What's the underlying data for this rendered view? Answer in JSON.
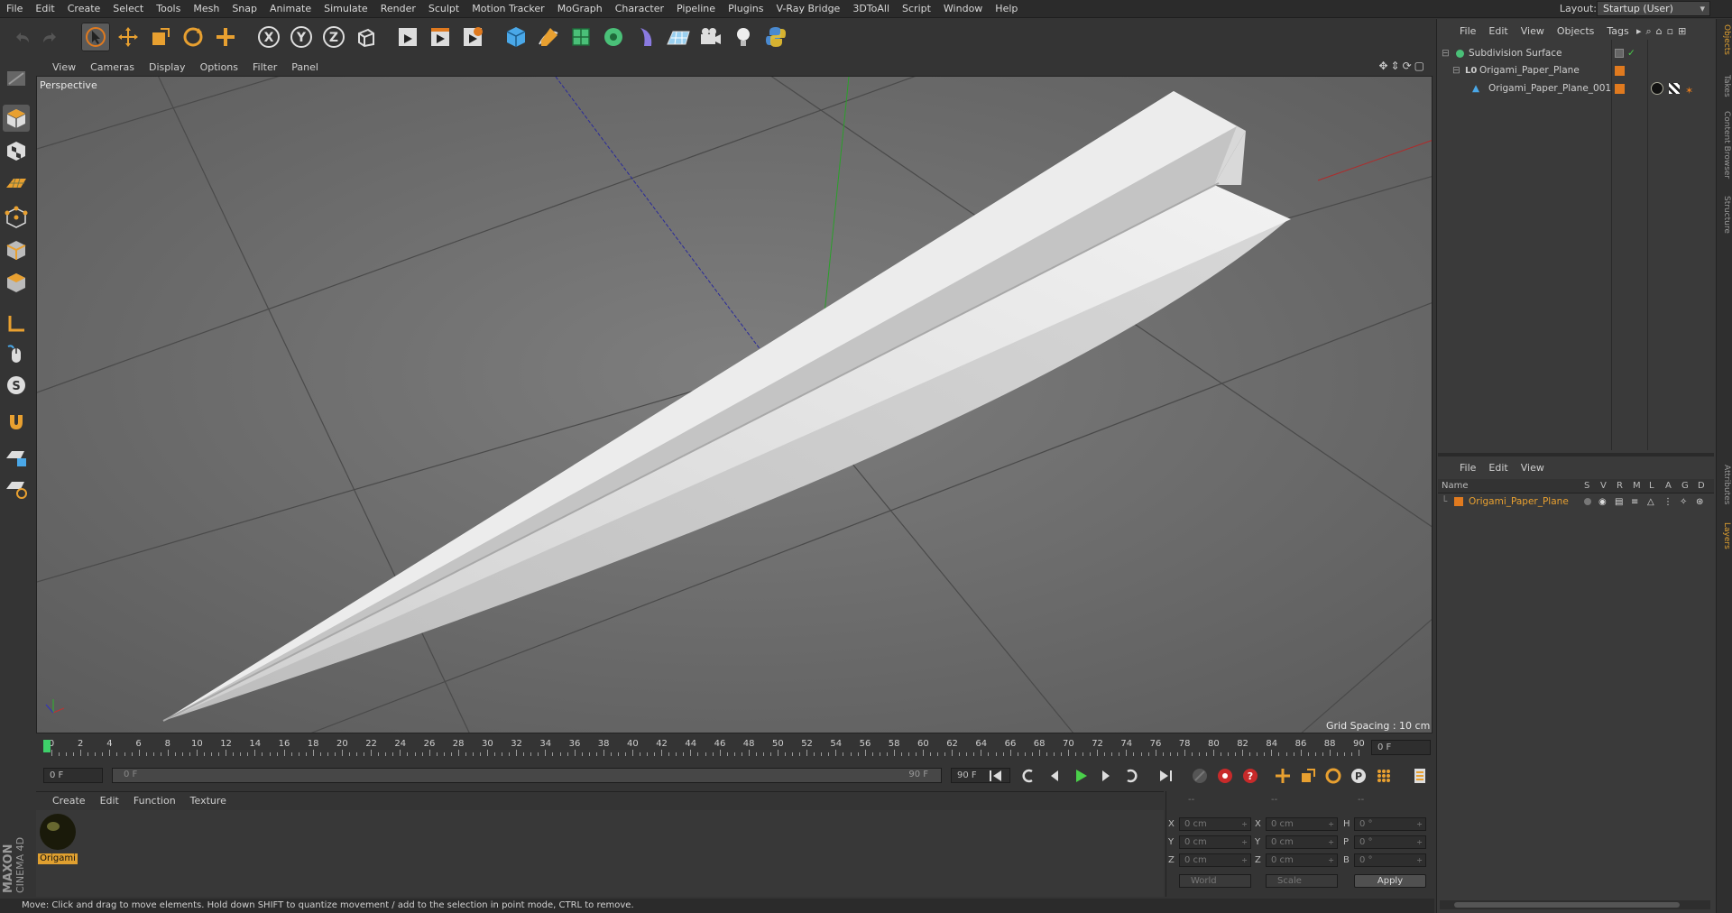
{
  "menubar": {
    "items": [
      "File",
      "Edit",
      "Create",
      "Select",
      "Tools",
      "Mesh",
      "Snap",
      "Animate",
      "Simulate",
      "Render",
      "Sculpt",
      "Motion Tracker",
      "MoGraph",
      "Character",
      "Pipeline",
      "Plugins",
      "V-Ray Bridge",
      "3DToAll",
      "Script",
      "Window",
      "Help"
    ],
    "layout_label": "Layout:",
    "layout_value": "Startup (User)"
  },
  "viewport": {
    "menu": [
      "View",
      "Cameras",
      "Display",
      "Options",
      "Filter",
      "Panel"
    ],
    "label": "Perspective",
    "grid_spacing": "Grid Spacing : 10 cm"
  },
  "timeline": {
    "ticks": [
      "0",
      "2",
      "4",
      "6",
      "8",
      "10",
      "12",
      "14",
      "16",
      "18",
      "20",
      "22",
      "24",
      "26",
      "28",
      "30",
      "32",
      "34",
      "36",
      "38",
      "40",
      "42",
      "44",
      "46",
      "48",
      "50",
      "52",
      "54",
      "56",
      "58",
      "60",
      "62",
      "64",
      "66",
      "68",
      "70",
      "72",
      "74",
      "76",
      "78",
      "80",
      "82",
      "84",
      "86",
      "88",
      "90"
    ],
    "current_frame_field": "0 F",
    "start_field": "0 F",
    "range_start": "0 F",
    "range_end": "90 F",
    "end_field": "90 F"
  },
  "material_panel": {
    "menu": [
      "Create",
      "Edit",
      "Function",
      "Texture"
    ],
    "material_name": "Origami"
  },
  "coords": {
    "header": [
      "--",
      "--",
      "--"
    ],
    "rows": [
      {
        "a": "X",
        "av": "0 cm",
        "b": "X",
        "bv": "0 cm",
        "c": "H",
        "cv": "0 °"
      },
      {
        "a": "Y",
        "av": "0 cm",
        "b": "Y",
        "bv": "0 cm",
        "c": "P",
        "cv": "0 °"
      },
      {
        "a": "Z",
        "av": "0 cm",
        "b": "Z",
        "bv": "0 cm",
        "c": "B",
        "cv": "0 °"
      }
    ],
    "world": "World",
    "scale": "Scale",
    "apply": "Apply"
  },
  "status": "Move: Click and drag to move elements. Hold down SHIFT to quantize movement / add to the selection in point mode, CTRL to remove.",
  "objects_panel": {
    "menu": [
      "File",
      "Edit",
      "View",
      "Objects",
      "Tags"
    ],
    "items": [
      {
        "name": "Subdivision Surface"
      },
      {
        "name": "Origami_Paper_Plane"
      },
      {
        "name": "Origami_Paper_Plane_001"
      }
    ]
  },
  "layers_panel": {
    "menu": [
      "File",
      "Edit",
      "View"
    ],
    "columns": [
      "Name",
      "S",
      "V",
      "R",
      "M",
      "L",
      "A",
      "G",
      "D"
    ],
    "layer_name": "Origami_Paper_Plane"
  },
  "side_tabs": [
    "Objects",
    "Takes",
    "Content Browser",
    "Structure",
    "Attributes",
    "Layers"
  ],
  "colors": {
    "accent": "#e0a030",
    "viewport_bg": "#6a6a6a",
    "panel_bg": "#343434"
  }
}
